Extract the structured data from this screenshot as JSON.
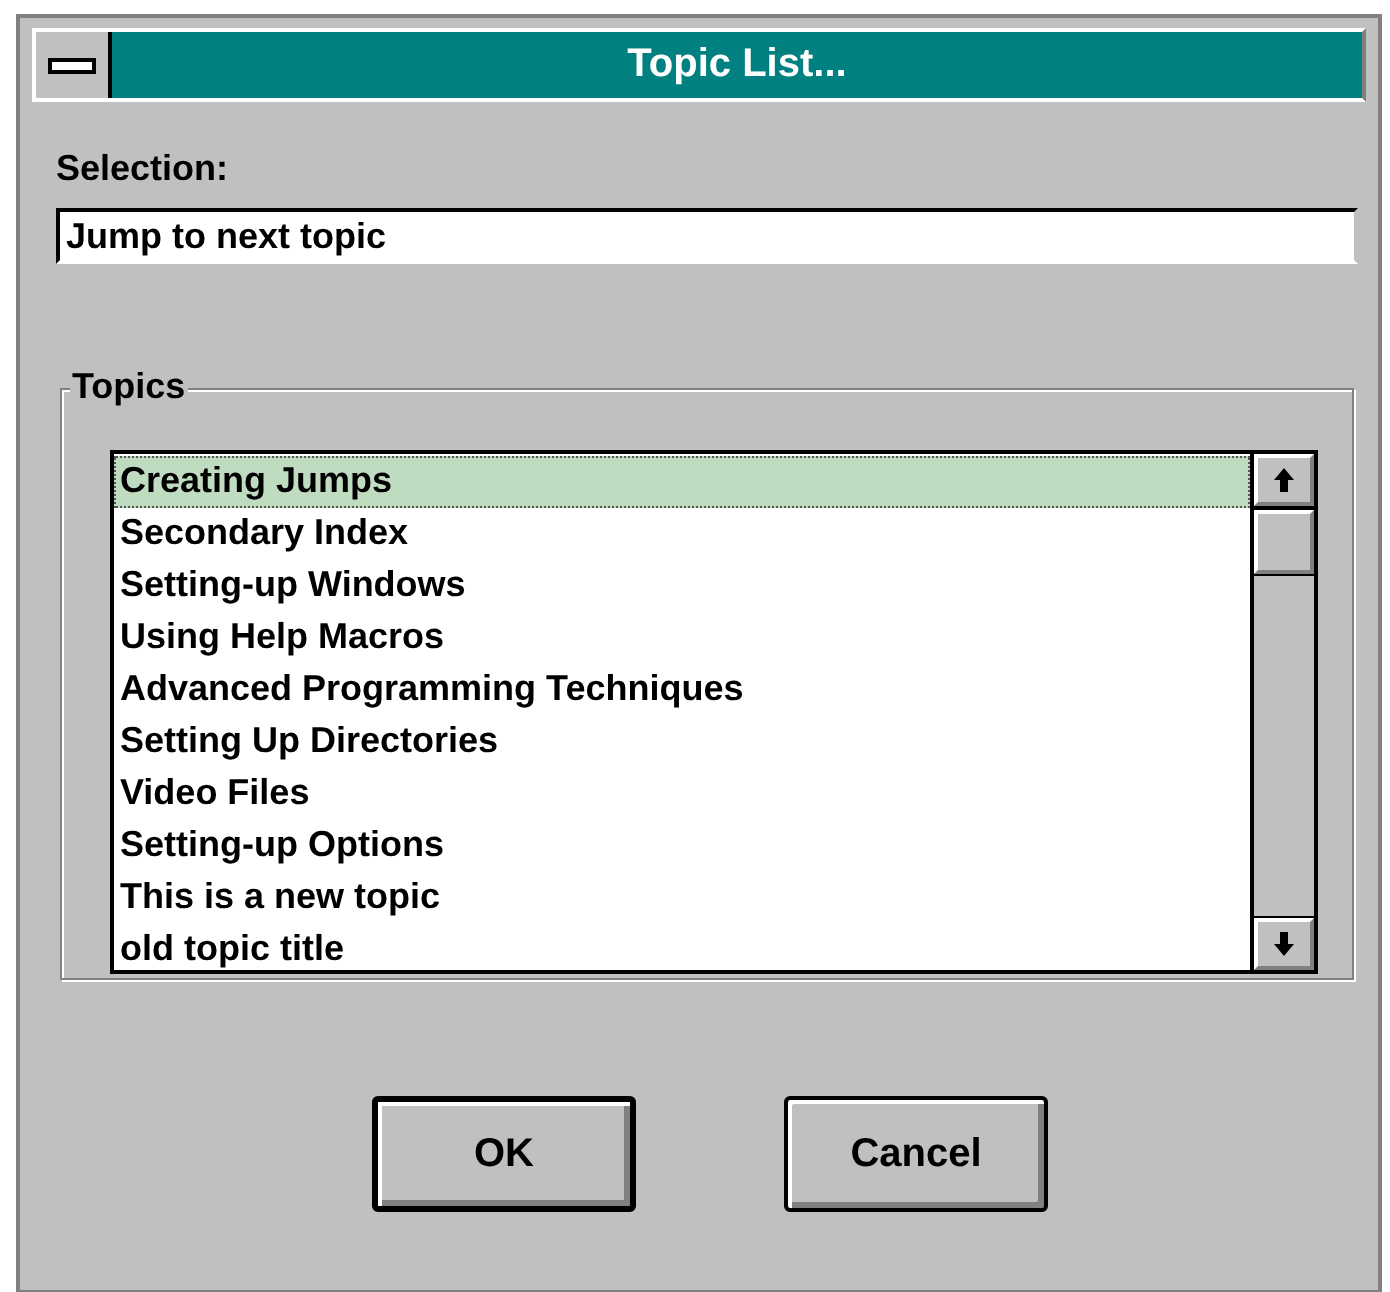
{
  "window": {
    "title": "Topic List..."
  },
  "selection": {
    "label": "Selection:",
    "value": "Jump to next topic"
  },
  "topics": {
    "label": "Topics",
    "items": [
      {
        "label": "Creating Jumps",
        "selected": true
      },
      {
        "label": "Secondary Index",
        "selected": false
      },
      {
        "label": "Setting-up Windows",
        "selected": false
      },
      {
        "label": "Using Help Macros",
        "selected": false
      },
      {
        "label": "Advanced Programming Techniques",
        "selected": false
      },
      {
        "label": "Setting Up Directories",
        "selected": false
      },
      {
        "label": "Video Files",
        "selected": false
      },
      {
        "label": "Setting-up Options",
        "selected": false
      },
      {
        "label": "This is a new topic",
        "selected": false
      },
      {
        "label": "old topic title",
        "selected": false
      }
    ]
  },
  "buttons": [
    {
      "label": "OK",
      "default": true
    },
    {
      "label": "Cancel",
      "default": false
    }
  ]
}
